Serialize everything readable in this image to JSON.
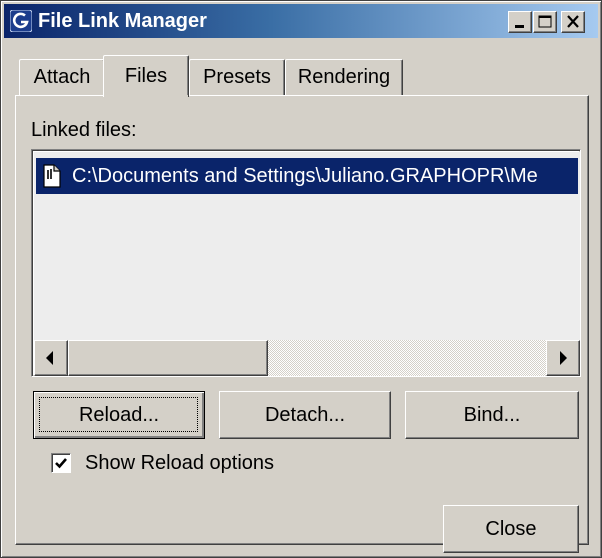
{
  "window": {
    "title": "File Link Manager"
  },
  "title_buttons": {
    "minimize_icon": "minimize-icon",
    "maximize_icon": "maximize-icon",
    "close_icon": "close-icon"
  },
  "tabs": [
    {
      "label": "Attach",
      "active": false
    },
    {
      "label": "Files",
      "active": true
    },
    {
      "label": "Presets",
      "active": false
    },
    {
      "label": "Rendering",
      "active": false
    }
  ],
  "files_panel": {
    "linked_files_label": "Linked files:",
    "linked_files": [
      {
        "path": "C:\\Documents and Settings\\Juliano.GRAPHOPR\\Me",
        "selected": true,
        "icon": "file-icon"
      }
    ],
    "scrollbar": {
      "left_icon": "arrow-left-icon",
      "right_icon": "arrow-right-icon"
    }
  },
  "buttons": {
    "reload": "Reload...",
    "detach": "Detach...",
    "bind": "Bind...",
    "close": "Close"
  },
  "options": {
    "show_reload_label": "Show Reload options",
    "show_reload_checked": true
  },
  "colors": {
    "title_bar_start": "#0a246a",
    "title_bar_end": "#a6caf0",
    "selection": "#0a246a",
    "face": "#d4d0c8"
  }
}
